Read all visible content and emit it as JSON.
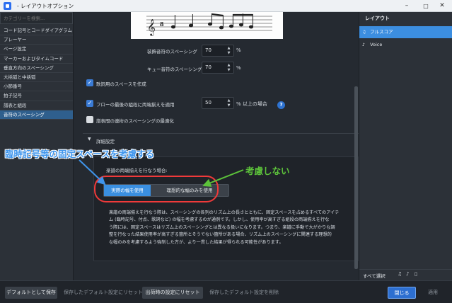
{
  "window": {
    "title": "- レイアウトオプション",
    "minimize": "–",
    "maximize": "□",
    "close": "✕"
  },
  "sidebar": {
    "search_placeholder": "カテゴリーを検索...",
    "items": [
      "コード記号とコードダイアグラム",
      "プレーヤー",
      "ページ設定",
      "マーカーおよびタイムコード",
      "垂直方向のスペーシング",
      "大括弧と中括弧",
      "小節番号",
      "拍子記号",
      "譜表と組段",
      "音符のスペーシング"
    ],
    "selected_index": 9
  },
  "settings": {
    "grace_note_spacing": {
      "label": "装飾音符のスペーシング",
      "value": "70",
      "unit": "%"
    },
    "cue_note_spacing": {
      "label": "キュー音符のスペーシング",
      "value": "70",
      "unit": "%"
    },
    "lyric_space": {
      "label": "歌詞用のスペースを作成",
      "checked": true
    },
    "justify_final": {
      "label": "フローの最後の組段に両端揃えを適用",
      "checked": true,
      "value": "50",
      "unit": "% 以上の場合"
    },
    "optimize_spacing": {
      "label": "譜表間の連桁のスペーシングの最適化",
      "checked": false
    }
  },
  "advanced": {
    "header": "詳細設定",
    "prompt": "楽譜の両端揃えを行なう場合:",
    "options": [
      "実際の幅を使用",
      "理想的な幅のみを使用"
    ],
    "selected_option": 0,
    "description": [
      "楽譜の両端揃えを行なう際は、スペーシングの各列のリズム上の長さとともに、固定スペースを占めるすべてのアイテ",
      "ム (臨時記号、付点、歌詞など) の幅を考慮するのが通例です。しかし、使用率が高すぎる組段の両端揃えを行な",
      "う際には、固定スペースはリズム上のスペーシングとは異なる扱いになります。つまり、楽譜に手動で大がかりな調",
      "整を行なった結果使用率が高すぎる箇所とそうでない箇所がある場合、リズム上のスペーシングに関連する理想的",
      "な幅のみを考慮するよう強制した方が、より一貫した結果が得られる可能性があります。"
    ]
  },
  "layouts": {
    "header": "レイアウト",
    "items": [
      {
        "label": "フルスコア",
        "icon": "♫",
        "selected": true
      },
      {
        "label": "Voice",
        "icon": "♪",
        "selected": false
      }
    ],
    "select_all": "すべて選択",
    "footer_icons": [
      "score-icon",
      "part-icon",
      "page-icon"
    ]
  },
  "footer": {
    "save_default": "デフォルトとして保存",
    "reset_saved": "保存したデフォルト設定にリセット",
    "reset_opening": "出荷時の設定にリセット",
    "delete_saved": "保存したデフォルト設定を削除",
    "close": "閉じる",
    "apply": "適用"
  },
  "annotations": {
    "left": "臨時記号等の固定スペースを考慮する",
    "right": "考慮しない",
    "colors": {
      "left": "#3f95ec",
      "right": "#5cc23a",
      "oval": "#f03a3a"
    }
  }
}
